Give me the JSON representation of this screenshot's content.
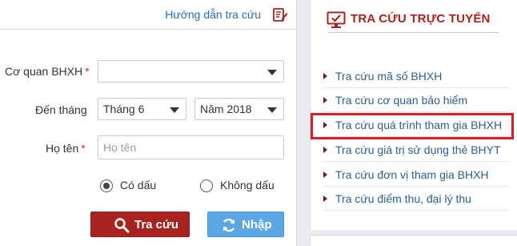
{
  "header": {
    "guide_link": "Hướng dẫn tra cứu",
    "guide_icon": "edit-document-icon"
  },
  "form": {
    "agency": {
      "label": "Cơ quan BHXH",
      "required_mark": "*",
      "value": ""
    },
    "month": {
      "label": "Đến tháng",
      "month_value": "Tháng 6",
      "year_value": "Năm 2018"
    },
    "name": {
      "label": "Họ tên",
      "required_mark": "*",
      "placeholder": "Họ tên",
      "value": ""
    },
    "accent": {
      "option_with": "Có dấu",
      "option_without": "Không dấu",
      "selected": "Có dấu"
    },
    "buttons": {
      "search": "Tra cứu",
      "reset": "Nhập"
    }
  },
  "sidebar": {
    "title": "TRA CỨU TRỰC TUYẾN",
    "title_icon": "monitor-check-icon",
    "items": [
      {
        "label": "Tra cứu mã số BHXH"
      },
      {
        "label": "Tra cứu cơ quan bảo hiểm"
      },
      {
        "label": "Tra cứu quá trình tham gia BHXH",
        "highlighted": true
      },
      {
        "label": "Tra cứu giá trị sử dụng thẻ BHYT"
      },
      {
        "label": "Tra cứu đơn vị tham gia BHXH"
      },
      {
        "label": "Tra cứu điểm thu, đại lý thu"
      }
    ]
  },
  "colors": {
    "accent_red": "#a8231f",
    "link_blue": "#2d5f91",
    "button_blue": "#5aa7e3",
    "highlight_red": "#e01b24"
  }
}
